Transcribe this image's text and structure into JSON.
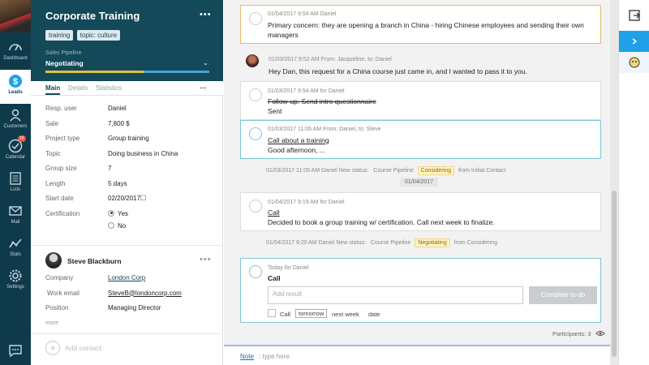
{
  "nav": {
    "items": [
      {
        "label": "Dashboard",
        "icon": "dashboard-icon"
      },
      {
        "label": "Leads",
        "icon": "leads-icon"
      },
      {
        "label": "Customers",
        "icon": "customers-icon"
      },
      {
        "label": "Calendar",
        "icon": "calendar-icon",
        "badge": "18"
      },
      {
        "label": "Lists",
        "icon": "lists-icon"
      },
      {
        "label": "Mail",
        "icon": "mail-icon"
      },
      {
        "label": "Stats",
        "icon": "stats-icon"
      },
      {
        "label": "Settings",
        "icon": "settings-icon"
      }
    ],
    "active": "Leads"
  },
  "deal": {
    "title": "Corporate Training",
    "tags": [
      "training",
      "topic: culture"
    ],
    "pipeline_label": "Sales Pipeline",
    "pipeline_stage": "Negotiating",
    "pipeline_progress": 0.6,
    "tabs": [
      "Main",
      "Details",
      "Statistics"
    ],
    "fields": {
      "resp_user": {
        "label": "Resp. user",
        "value": "Daniel"
      },
      "sale": {
        "label": "Sale",
        "value": "7,800 $"
      },
      "project_type": {
        "label": "Project type",
        "value": "Group training"
      },
      "topic": {
        "label": "Topic",
        "value": "Doing business in China"
      },
      "group_size": {
        "label": "Group size",
        "value": "7"
      },
      "length": {
        "label": "Length",
        "value": "5 days"
      },
      "start_date": {
        "label": "Start date",
        "value": "02/20/2017"
      },
      "certification": {
        "label": "Certification",
        "yes": "Yes",
        "no": "No",
        "selected": "Yes"
      }
    }
  },
  "contact": {
    "name": "Steve Blackburn",
    "company_label": "Company",
    "company": "London Corp",
    "email_label": "Work email",
    "email": "SteveB@londoncorp.com",
    "position_label": "Position",
    "position": "Managing Director",
    "more": "more",
    "add_contact": "Add contact"
  },
  "feed": {
    "note1": {
      "meta": "01/04/2017 9:54 AM Daniel",
      "text": "Primary concern: they are opening a branch in China - hiring Chinese employees and sending their own managers"
    },
    "msg1": {
      "meta": "01/03/2017 9:52 AM From: Jacqueline, to: Daniel",
      "text": "Hey Dan, this request for a China course just came in, and I wanted to pass it to you."
    },
    "task1": {
      "meta": "01/03/2017 9:54 AM for Daniel",
      "title": "Follow-up: Send intro questionnaire",
      "text": "Sent"
    },
    "mail1": {
      "meta": "01/03/2017 11:05 AM From: Daniel, to: Steve",
      "title": "Call about a training",
      "text": "Good afternoon, ..."
    },
    "status1": {
      "prefix": "01/03/2017 11:05 AM Daniel New status:",
      "pipeline": "Course Pipeline",
      "stage": "Considering",
      "suffix": "from Initial Contact"
    },
    "date_chip": "01/04/2017",
    "task2": {
      "meta": "01/04/2017 9:19 AM for Daniel",
      "title": "Call",
      "text": "Decided to book a group training w/ certification. Call next week to finalize."
    },
    "status2": {
      "prefix": "01/04/2017 9:20 AM Daniel New status:",
      "pipeline": "Course Pipeline",
      "stage": "Negotiating",
      "suffix": "from Considering"
    },
    "todo": {
      "meta": "Today for Daniel",
      "title": "Call",
      "placeholder": "Add result",
      "button": "Complete to-do",
      "options": [
        "Call",
        "tomorrow",
        "next week",
        "date"
      ],
      "selected": "tomorrow"
    },
    "participants": "Participants: 3",
    "note_label": "Note",
    "note_placeholder": ": type here"
  },
  "colors": {
    "sidebar": "#0f3a4c",
    "header": "#134959",
    "accent": "#1fa0e8",
    "status_pill": "#fff3c8",
    "warn_border": "#e8b86a"
  }
}
